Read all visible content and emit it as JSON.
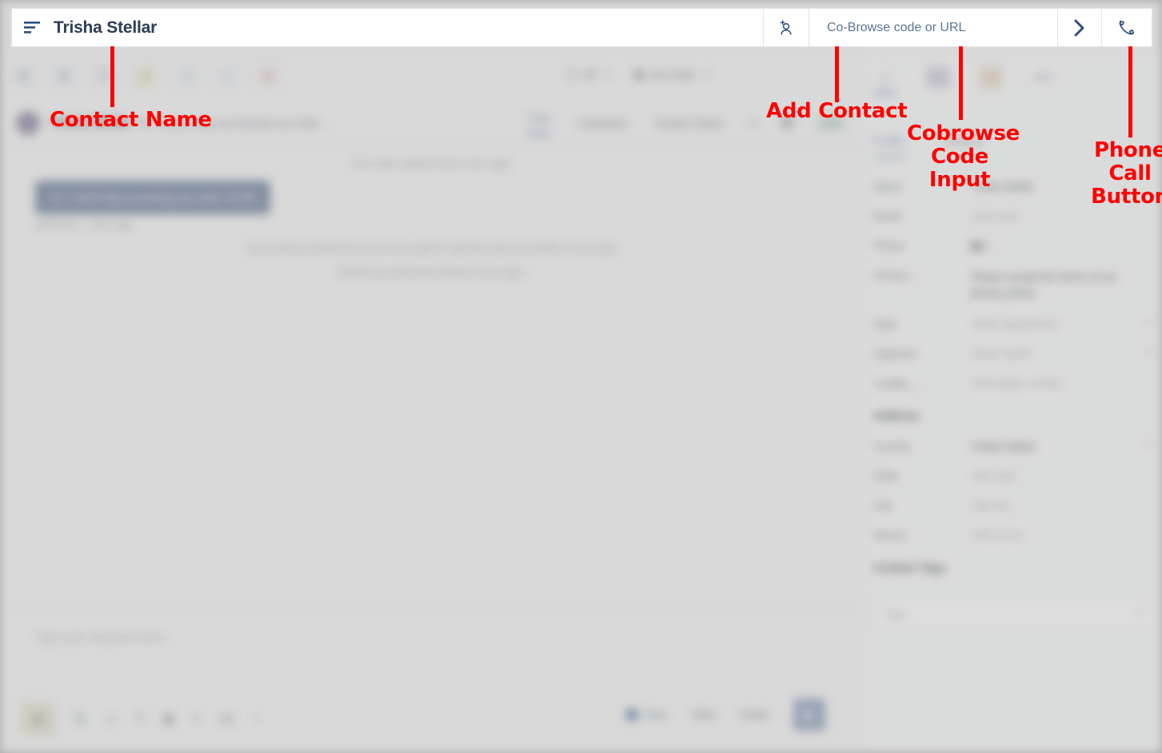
{
  "topbar": {
    "menu_icon": "hamburger-menu-icon",
    "title": "Trisha Stellar",
    "add_contact_icon": "add-person-icon",
    "cobrowse_placeholder": "Co-Browse code or URL",
    "cobrowse_value": "",
    "go_icon": "chevron-right-icon",
    "phone_icon": "phone-call-icon"
  },
  "channel_icons": [
    {
      "name": "messenger-icon",
      "glyph": "✉",
      "style": "default"
    },
    {
      "name": "email-icon",
      "glyph": "✉",
      "style": "default"
    },
    {
      "name": "phone-icon",
      "glyph": "✆",
      "style": "default"
    },
    {
      "name": "pending-icon",
      "glyph": "■",
      "style": "warn"
    },
    {
      "name": "chat-icon",
      "glyph": "◑",
      "style": "default"
    },
    {
      "name": "search-icon",
      "glyph": "⌕",
      "style": "default"
    },
    {
      "name": "alert-icon",
      "glyph": "●",
      "style": "alert"
    }
  ],
  "filters": {
    "type_filter": "All",
    "type_filter_icon": "tag-icon",
    "date_filter": "Any Date",
    "date_filter_icon": "calendar-icon",
    "caret": "▼"
  },
  "conversation": {
    "avatar": "contact-avatar",
    "contact_name": "Trisha Stellar",
    "preview": "Hi, I need help accessing my orde...",
    "tabs": [
      {
        "label": "Chat",
        "active": true
      },
      {
        "label": "Cobrowse",
        "active": false
      },
      {
        "label": "Screen Share",
        "active": false
      }
    ],
    "actions": [
      {
        "name": "transfer-icon",
        "glyph": "↪"
      },
      {
        "name": "trash-icon",
        "glyph": "🗑"
      }
    ],
    "add_contact_label": "Add"
  },
  "transcript": {
    "system_start": "The visitor started chat (1 hour ago)",
    "message": {
      "text": "Hi, I need help accessing my order #1246",
      "meta": "#0041415  ·  1 hour ago"
    },
    "system_transfer": "You're being transferred to one of our agents, they'll be with you shortly (1 hour ago)",
    "system_join": "Rachel just joined the thread (1 hour ago)"
  },
  "composer": {
    "placeholder": "Type your response here...",
    "tools": [
      {
        "name": "canned-response-icon",
        "glyph": "▤",
        "active": true
      },
      {
        "name": "attachment-icon",
        "glyph": "📎",
        "active": false
      },
      {
        "name": "emoji-icon",
        "glyph": "☺",
        "active": false
      },
      {
        "name": "pen-icon",
        "glyph": "✎",
        "active": false
      },
      {
        "name": "image-icon",
        "glyph": "▦",
        "active": false
      },
      {
        "name": "link-icon",
        "glyph": "⚭",
        "active": false
      },
      {
        "name": "text-format-icon",
        "glyph": "Aa",
        "active": false
      },
      {
        "name": "location-icon",
        "glyph": "♁",
        "active": false
      }
    ],
    "channels": [
      {
        "label": "Chat",
        "checked": true
      },
      {
        "label": "SMS",
        "checked": false
      },
      {
        "label": "Email",
        "checked": false
      }
    ],
    "send_icon": "send-triangle-icon"
  },
  "right_panel": {
    "icons": [
      {
        "name": "info-icon",
        "glyph": "ⓘ",
        "style": "plain",
        "active": true
      },
      {
        "name": "notes-badge-icon",
        "glyph": "NOTE",
        "style": "purple",
        "active": false
      },
      {
        "name": "orders-badge-icon",
        "glyph": "CART",
        "style": "orange",
        "active": false
      },
      {
        "name": "apps-badge-icon",
        "glyph": "APPS",
        "style": "plainpurple",
        "active": false
      }
    ],
    "tabs": [
      {
        "label": "Profile",
        "active": true
      },
      {
        "label": "Timeline",
        "active": false
      }
    ],
    "fields": [
      {
        "label": "Name",
        "value": "Trisha Stellar",
        "placeholder": false,
        "chevron": false
      },
      {
        "label": "Email",
        "value": "Add email",
        "placeholder": true,
        "chevron": false
      },
      {
        "label": "Phone",
        "value": "1",
        "placeholder": true,
        "chevron": false,
        "flag": true
      },
      {
        "label": "Privacy ...",
        "value": "Please accept the terms of our privacy policy",
        "placeholder": false,
        "chevron": false
      },
      {
        "label": "Dept",
        "value": "Select department",
        "placeholder": true,
        "chevron": true
      },
      {
        "label": "Segment",
        "value": "Select option",
        "placeholder": true,
        "chevron": true
      },
      {
        "label": "Loyalty_...",
        "value": "Add loyalty number",
        "placeholder": true,
        "chevron": false
      }
    ],
    "address_title": "Address",
    "address_fields": [
      {
        "label": "Country",
        "value": "United States",
        "placeholder": false,
        "chevron": true
      },
      {
        "label": "State",
        "value": "Add state",
        "placeholder": true,
        "chevron": false
      },
      {
        "label": "City",
        "value": "Add city",
        "placeholder": true,
        "chevron": false
      },
      {
        "label": "Source",
        "value": "Add source",
        "placeholder": true,
        "chevron": false
      }
    ],
    "tags_title": "Contact Tags",
    "tags_placeholder": "Tags",
    "tags_caret": "▼"
  },
  "annotations": {
    "color": "#ff0000",
    "items": [
      {
        "label": "Contact Name",
        "align": "left"
      },
      {
        "label": "Add Contact",
        "align": "left"
      },
      {
        "label": "Cobrowse\nCode\nInput",
        "align": "center"
      },
      {
        "label": "Phone\nCall\nButton",
        "align": "center"
      }
    ]
  }
}
